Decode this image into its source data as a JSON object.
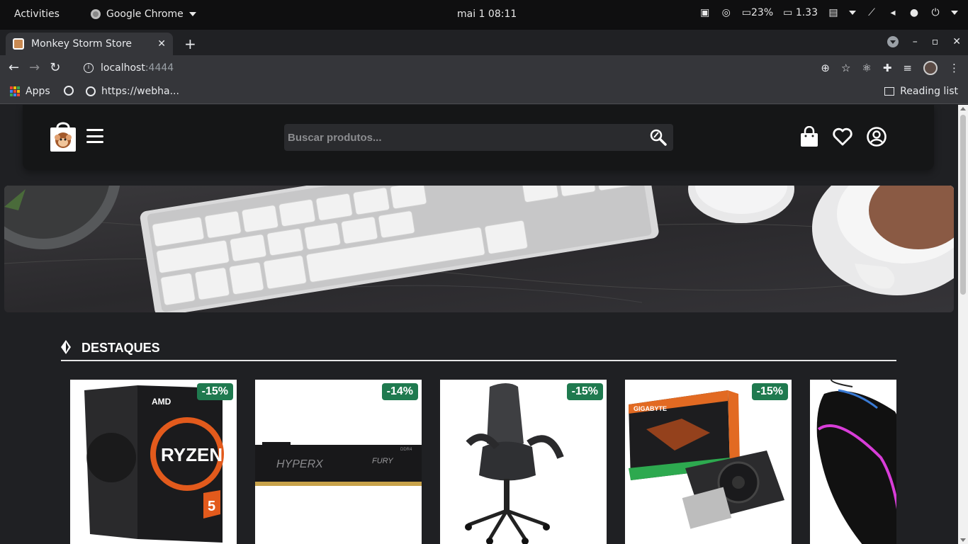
{
  "os_bar": {
    "activities": "Activities",
    "app_name": "Google Chrome",
    "clock": "mai 1  08:11",
    "battery": "23%",
    "display": "1.33"
  },
  "browser": {
    "tab_title": "Monkey Storm Store",
    "url_host": "localhost",
    "url_port": ":4444",
    "bookmarks": [
      {
        "label": "Apps"
      },
      {
        "label": ""
      },
      {
        "label": "https://webha..."
      }
    ],
    "reading_list": "Reading list"
  },
  "store": {
    "search_placeholder": "Buscar produtos...",
    "section_title": "DESTAQUES",
    "products": [
      {
        "name": "AMD Ryzen 5",
        "discount": "-15%"
      },
      {
        "name": "HyperX Fury DDR4",
        "discount": "-14%"
      },
      {
        "name": "Gaming chair",
        "discount": "-15%"
      },
      {
        "name": "Gigabyte GeForce GTX",
        "discount": "-15%"
      },
      {
        "name": "RGB mouse",
        "discount": ""
      }
    ]
  },
  "icons": [
    "logo-icon",
    "menu-icon",
    "search-icon",
    "bag-icon",
    "heart-icon",
    "account-icon"
  ],
  "colors": {
    "accent": "#1f7a4f",
    "header_bg": "#151617",
    "page_bg": "#1f2023"
  }
}
